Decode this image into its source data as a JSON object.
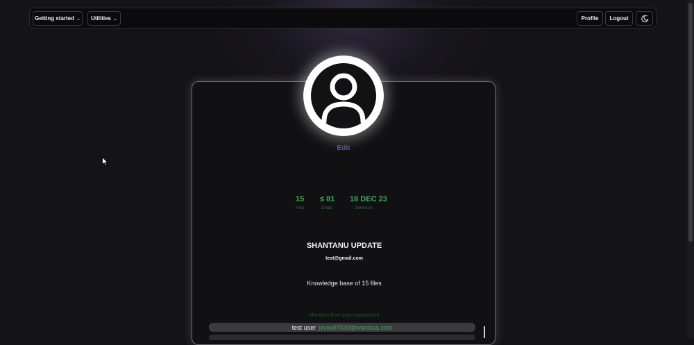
{
  "navbar": {
    "getting_started": "Getting started",
    "utilities": "Utilities",
    "profile": "Profile",
    "logout": "Logout",
    "theme_icon": "moon-sun-icon"
  },
  "profile": {
    "edit_label": "Edit",
    "name": "SHANTANU UPDATE",
    "email": "test@gmail.com",
    "knowledge_base": "Knowledge base of 15 files"
  },
  "stats": [
    {
      "value": "15",
      "label": "Files"
    },
    {
      "value": "≤ 81",
      "label": "Chats"
    },
    {
      "value": "18 DEC 23",
      "label": "Joined on"
    }
  ],
  "members": {
    "heading": "Members from your organization",
    "rows": [
      {
        "name": "test user",
        "email": "jeyiw97020@wanlxsa.com"
      }
    ]
  },
  "colors": {
    "accent_green": "#44a85a",
    "background": "#141316"
  }
}
